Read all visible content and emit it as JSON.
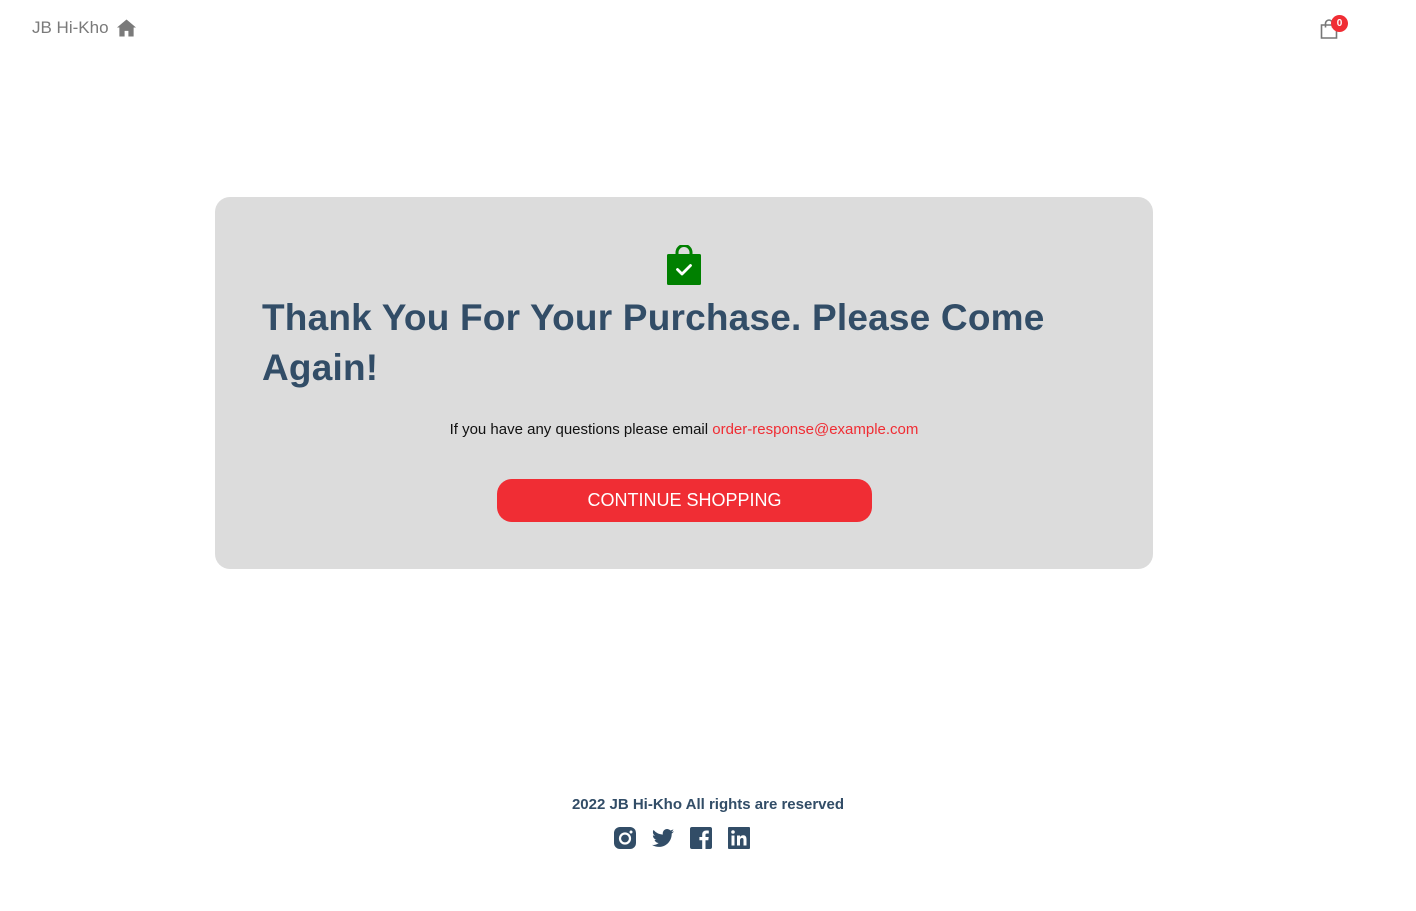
{
  "navbar": {
    "logo_text": "JB Hi-Kho",
    "home_icon": "home-icon",
    "cart_icon": "shopping-bag-icon",
    "cart_count": "0"
  },
  "success": {
    "icon": "shopping-bag-check-icon",
    "heading": "Thank You For Your Purchase. Please Come Again!",
    "email_prompt": "If you have any questions please email",
    "email_address": "order-response@example.com",
    "button_label": "CONTINUE SHOPPING"
  },
  "footer": {
    "copyright": "2022 JB Hi-Kho All rights are reserved",
    "social": [
      "instagram-icon",
      "twitter-icon",
      "facebook-icon",
      "linkedin-icon"
    ]
  },
  "colors": {
    "accent": "#f02d34",
    "heading": "#324d67",
    "card_bg": "#dcdcdc",
    "success_green": "#008000"
  }
}
